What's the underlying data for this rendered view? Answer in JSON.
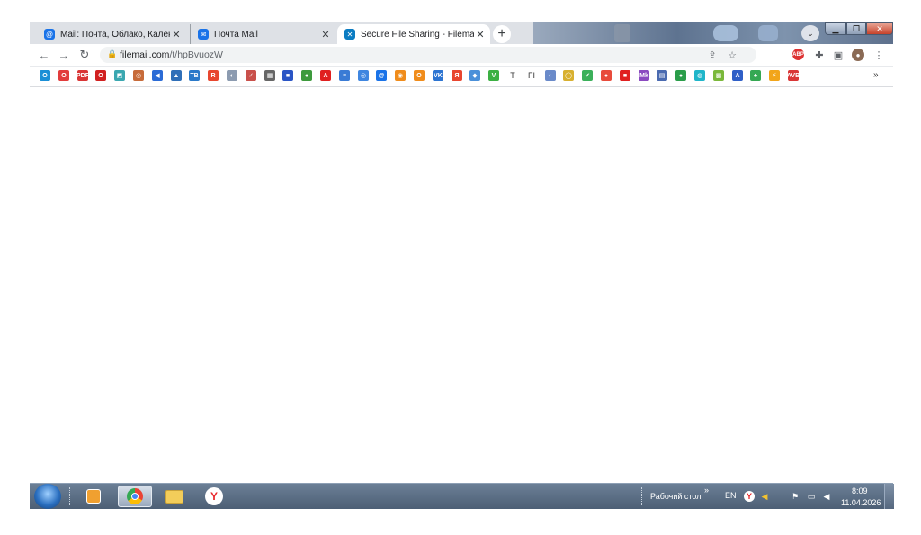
{
  "tabs": [
    {
      "title": "Mail: Почта, Облако, Календарь",
      "favicon": "mail-at-icon",
      "color": "#1a73e8"
    },
    {
      "title": "Почта Mail",
      "favicon": "mail-envelope-icon",
      "color": "#1a73e8"
    },
    {
      "title": "Secure File Sharing - Filemai",
      "favicon": "filemail-icon",
      "color": "#0b7cc2",
      "active": true
    }
  ],
  "tab_close_glyph": "✕",
  "new_tab_glyph": "+",
  "address_bar": {
    "url_host": "filemail.com",
    "url_path": "/t/hpBvuozW"
  },
  "bookmarks": [
    {
      "icon": "O",
      "color": "#1a8fd6"
    },
    {
      "icon": "O",
      "color": "#e23c3c"
    },
    {
      "icon": "PDF",
      "color": "#d93636"
    },
    {
      "icon": "O",
      "color": "#d12020"
    },
    {
      "icon": "◩",
      "color": "#3aa7b0"
    },
    {
      "icon": "◎",
      "color": "#c76b3a"
    },
    {
      "icon": "◀",
      "color": "#2b6bd6"
    },
    {
      "icon": "▲",
      "color": "#2f6fb8"
    },
    {
      "icon": "TB",
      "color": "#2a79c9"
    },
    {
      "icon": "R",
      "color": "#e8472f"
    },
    {
      "icon": "◐",
      "color": "#8c9bb0"
    },
    {
      "icon": "✓",
      "color": "#c9504b"
    },
    {
      "icon": "▦",
      "color": "#666666"
    },
    {
      "icon": "■",
      "color": "#2a55c5"
    },
    {
      "icon": "●",
      "color": "#3d9a3d"
    },
    {
      "icon": "A",
      "color": "#e02020"
    },
    {
      "icon": "≡",
      "color": "#3a7bd5"
    },
    {
      "icon": "◎",
      "color": "#3f86e0"
    },
    {
      "icon": "@",
      "color": "#1a73e8"
    },
    {
      "icon": "◉",
      "color": "#f08c1b"
    },
    {
      "icon": "O",
      "color": "#f08c1b"
    },
    {
      "icon": "VK",
      "color": "#2c74d1"
    },
    {
      "icon": "Я",
      "color": "#e8462f"
    },
    {
      "icon": "◆",
      "color": "#4a90d9"
    },
    {
      "icon": "V",
      "color": "#3cb043"
    },
    {
      "icon": "T",
      "color": "transparent"
    },
    {
      "icon": "FI",
      "color": "transparent"
    },
    {
      "icon": "◐",
      "color": "#6a8ac9"
    },
    {
      "icon": "◯",
      "color": "#d8b030"
    },
    {
      "icon": "✔",
      "color": "#3bb05a"
    },
    {
      "icon": "●",
      "color": "#e84b3c"
    },
    {
      "icon": "■",
      "color": "#e02020"
    },
    {
      "icon": "Mk",
      "color": "#8a4ac0"
    },
    {
      "icon": "▤",
      "color": "#4a6ab0"
    },
    {
      "icon": "●",
      "color": "#2a9d4a"
    },
    {
      "icon": "◍",
      "color": "#1fb5c9"
    },
    {
      "icon": "▩",
      "color": "#7ab83a"
    },
    {
      "icon": "A",
      "color": "#2f5fc7"
    },
    {
      "icon": "♣",
      "color": "#35a853"
    },
    {
      "icon": "⚡",
      "color": "#f2a51a"
    },
    {
      "icon": "AVB",
      "color": "#d93636"
    }
  ],
  "bookmarks_more": "»",
  "taskbar": {
    "desktop_label": "Рабочий стол",
    "desktop_chevron": "»",
    "language": "EN",
    "time": "8:09",
    "date": "11.04.2026"
  }
}
